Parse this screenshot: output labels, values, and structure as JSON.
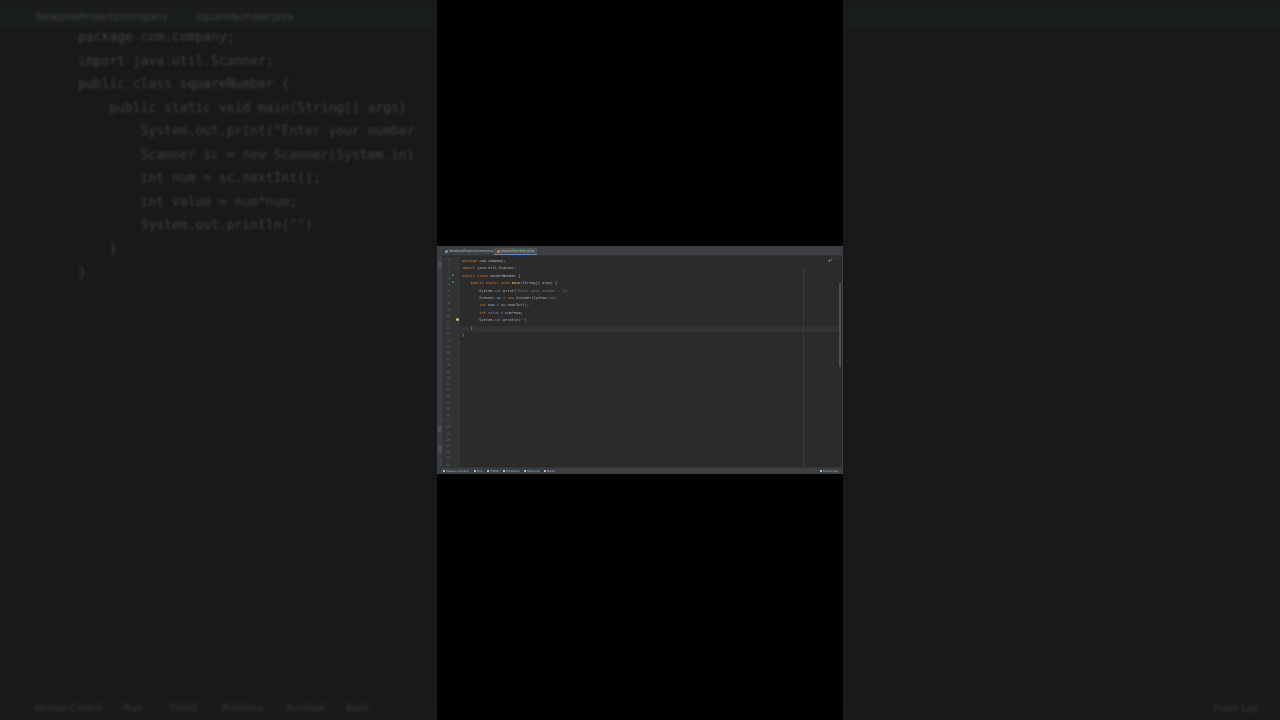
{
  "window": {
    "tabs": [
      {
        "label": "NewJavaProjects/company",
        "active": false
      },
      {
        "label": "squareNumber.java",
        "active": true
      }
    ],
    "inspection": "▲1 ˄ ˅"
  },
  "editor": {
    "line_numbers": [
      "1",
      "2",
      "3",
      "4",
      "5",
      "6",
      "7",
      "8",
      "9",
      "10",
      "11",
      "12",
      "13",
      "14",
      "15",
      "16",
      "17",
      "18",
      "19",
      "20",
      "21",
      "22",
      "23",
      "24",
      "25",
      "26",
      "27",
      "28",
      "29",
      "30",
      "31",
      "32",
      "33",
      "34"
    ],
    "lines": [
      {
        "parts": [
          {
            "t": "package ",
            "c": "k"
          },
          {
            "t": "com.company;",
            "c": ""
          }
        ]
      },
      {
        "parts": [
          {
            "t": "import ",
            "c": "k"
          },
          {
            "t": "java.util.Scanner;",
            "c": ""
          }
        ]
      },
      {
        "parts": [
          {
            "t": "public class ",
            "c": "k"
          },
          {
            "t": "squareNumber {",
            "c": ""
          }
        ]
      },
      {
        "parts": [
          {
            "t": "    public static void ",
            "c": "k"
          },
          {
            "t": "main",
            "c": "m"
          },
          {
            "t": "(String[] args) {",
            "c": ""
          }
        ]
      },
      {
        "parts": [
          {
            "t": "        System.",
            "c": ""
          },
          {
            "t": "out",
            "c": "f"
          },
          {
            "t": ".print(",
            "c": ""
          },
          {
            "t": "\"Enter your number : \"",
            "c": "s"
          },
          {
            "t": ");",
            "c": ""
          }
        ]
      },
      {
        "parts": [
          {
            "t": "        Scanner sc = ",
            "c": ""
          },
          {
            "t": "new ",
            "c": "k"
          },
          {
            "t": "Scanner(System.",
            "c": ""
          },
          {
            "t": "in",
            "c": "f"
          },
          {
            "t": ");",
            "c": ""
          }
        ]
      },
      {
        "parts": [
          {
            "t": "        ",
            "c": ""
          },
          {
            "t": "int ",
            "c": "k"
          },
          {
            "t": "num = sc.nextInt();",
            "c": ""
          }
        ]
      },
      {
        "parts": [
          {
            "t": "        ",
            "c": ""
          },
          {
            "t": "int ",
            "c": "k"
          },
          {
            "t": "value",
            "c": "f"
          },
          {
            "t": " = num*num;",
            "c": ""
          }
        ]
      },
      {
        "parts": [
          {
            "t": "        System.",
            "c": ""
          },
          {
            "t": "out",
            "c": "f"
          },
          {
            "t": ".println(",
            "c": ""
          },
          {
            "t": "\"\"",
            "c": "s"
          },
          {
            "t": ")",
            "c": ""
          }
        ]
      },
      {
        "parts": [
          {
            "t": "    }",
            "c": ""
          }
        ]
      },
      {
        "parts": [
          {
            "t": "}",
            "c": ""
          }
        ]
      }
    ]
  },
  "status_bar": {
    "items": [
      "Version Control",
      "Run",
      "TODO",
      "Problems",
      "Terminal",
      "Build"
    ],
    "right": "Event Log"
  },
  "background": {
    "tab_left": "NewJavaProjects/company",
    "tab_active": "squareNumber.java",
    "lines": [
      "package com.company;",
      "import java.util.Scanner;",
      "public class squareNumber {",
      "    public static void main(String[] args)",
      "        System.out.print(\"Enter your number",
      "        Scanner sc = new Scanner(System.in)",
      "        int num = sc.nextInt();",
      "        int value = num*num;",
      "        System.out.println(\"\")",
      "    }",
      "}"
    ],
    "status_items": [
      "Version Control",
      "Run",
      "TODO",
      "Problems",
      "Terminal",
      "Build"
    ],
    "status_right": "Event Log"
  }
}
